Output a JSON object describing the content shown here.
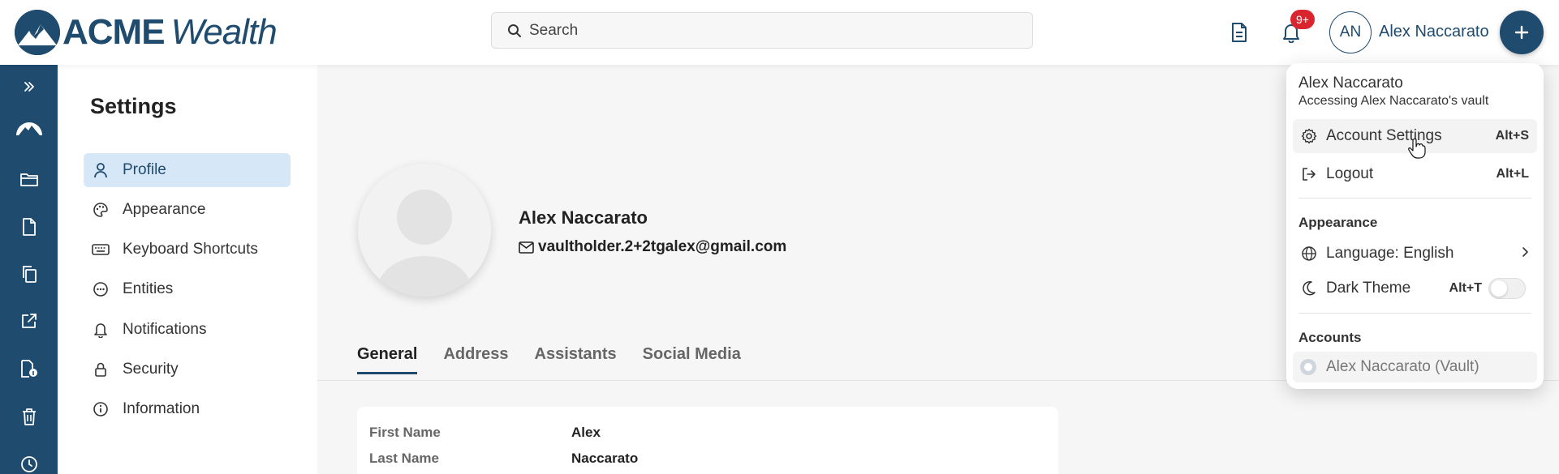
{
  "brand": {
    "name_bold": "ACME",
    "name_italic": "Wealth",
    "color": "#1e4b6e"
  },
  "search": {
    "placeholder": "Search"
  },
  "header": {
    "notification_badge": "9+",
    "avatar_initials": "AN",
    "user_name": "Alex Naccarato"
  },
  "rail": {
    "items": [
      "expand-icon",
      "home-mountain-icon",
      "folder-icon",
      "document-icon",
      "copy-icon",
      "share-icon",
      "file-info-icon",
      "trash-icon",
      "clock-icon"
    ]
  },
  "settings": {
    "title": "Settings",
    "nav": [
      {
        "label": "Profile",
        "icon": "user-icon",
        "active": true
      },
      {
        "label": "Appearance",
        "icon": "palette-icon"
      },
      {
        "label": "Keyboard Shortcuts",
        "icon": "keyboard-icon"
      },
      {
        "label": "Entities",
        "icon": "entities-icon"
      },
      {
        "label": "Notifications",
        "icon": "bell-icon"
      },
      {
        "label": "Security",
        "icon": "lock-icon"
      },
      {
        "label": "Information",
        "icon": "info-icon"
      }
    ]
  },
  "profile": {
    "name": "Alex Naccarato",
    "email": "vaultholder.2+2tgalex@gmail.com",
    "tabs": [
      "General",
      "Address",
      "Assistants",
      "Social Media"
    ],
    "active_tab": "General",
    "fields": [
      {
        "label": "First Name",
        "value": "Alex"
      },
      {
        "label": "Last Name",
        "value": "Naccarato"
      }
    ]
  },
  "menu": {
    "name": "Alex Naccarato",
    "subtitle": "Accessing Alex Naccarato's vault",
    "items": [
      {
        "label": "Account Settings",
        "shortcut": "Alt+S",
        "icon": "gear-icon"
      },
      {
        "label": "Logout",
        "shortcut": "Alt+L",
        "icon": "logout-icon"
      }
    ],
    "appearance_title": "Appearance",
    "language_label": "Language: English",
    "dark_theme_label": "Dark Theme",
    "dark_theme_shortcut": "Alt+T",
    "dark_theme_on": false,
    "accounts_title": "Accounts",
    "account_label": "Alex Naccarato (Vault)"
  }
}
